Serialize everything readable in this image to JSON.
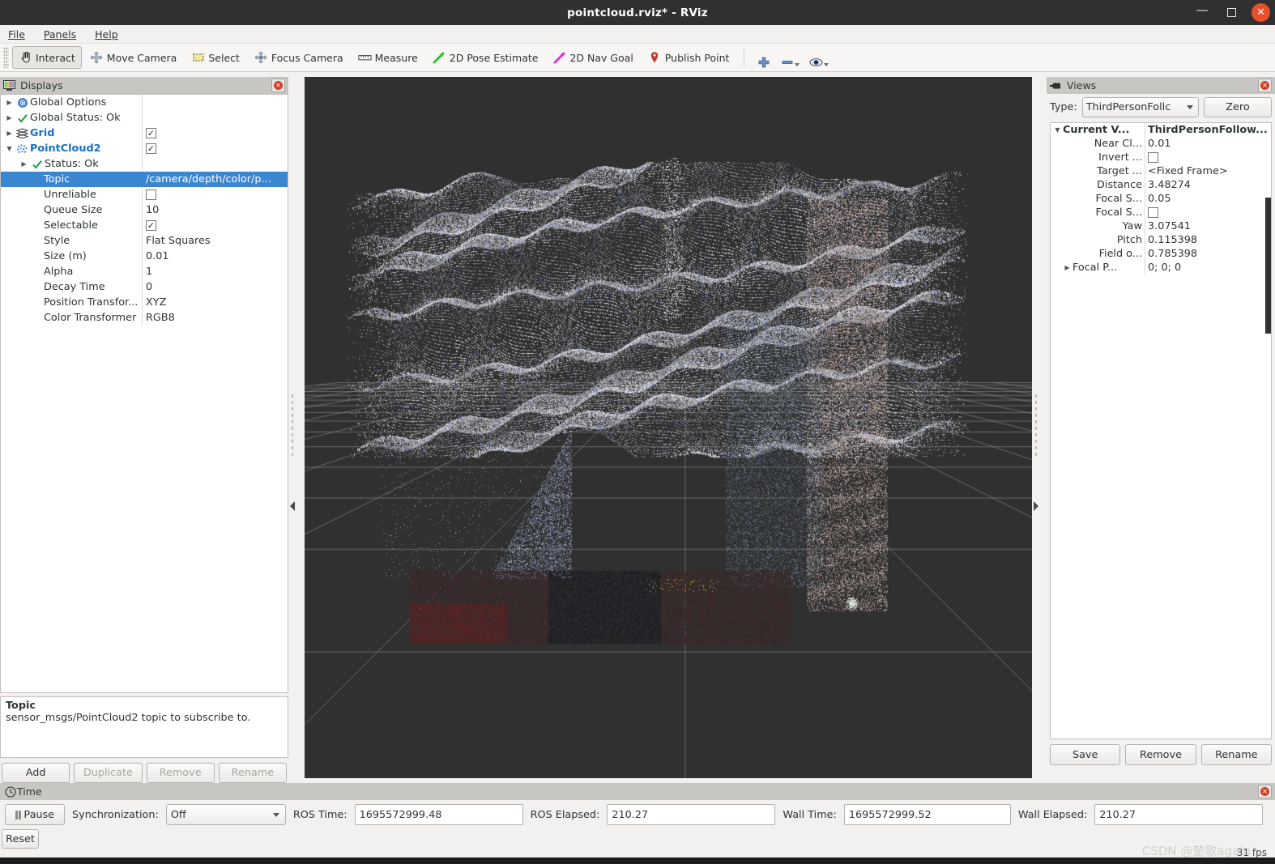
{
  "window": {
    "title": "pointcloud.rviz* - RViz",
    "minimize_label": "—",
    "maximize_label": "",
    "close_label": "✕"
  },
  "menubar": {
    "items": [
      {
        "label": "File"
      },
      {
        "label": "Panels"
      },
      {
        "label": "Help"
      }
    ]
  },
  "toolbar": {
    "buttons": [
      {
        "label": "Interact",
        "icon": "hand-cursor-icon",
        "active": true
      },
      {
        "label": "Move Camera",
        "icon": "move-camera-icon",
        "active": false
      },
      {
        "label": "Select",
        "icon": "select-rect-icon",
        "active": false
      },
      {
        "label": "Focus Camera",
        "icon": "focus-camera-icon",
        "active": false
      },
      {
        "label": "Measure",
        "icon": "ruler-icon",
        "active": false
      },
      {
        "label": "2D Pose Estimate",
        "icon": "green-arrow-icon",
        "active": false
      },
      {
        "label": "2D Nav Goal",
        "icon": "magenta-arrow-icon",
        "active": false
      },
      {
        "label": "Publish Point",
        "icon": "map-pin-icon",
        "active": false
      }
    ],
    "extra_icons": [
      {
        "name": "add-tool-icon",
        "glyph": "plus"
      },
      {
        "name": "remove-tool-icon",
        "glyph": "minus"
      },
      {
        "name": "visibility-eye-icon",
        "glyph": "eye"
      }
    ]
  },
  "displays": {
    "header": "Displays",
    "rows": [
      {
        "arrow": "right",
        "icon": "gear-icon",
        "name": "Global Options",
        "value": "",
        "value_type": "none",
        "indent": 0,
        "bold": false,
        "selected": false
      },
      {
        "arrow": "right",
        "icon": "check-icon",
        "name": "Global Status: Ok",
        "value": "",
        "value_type": "none",
        "indent": 0,
        "bold": false,
        "selected": false
      },
      {
        "arrow": "right",
        "icon": "grid-icon",
        "name": "Grid",
        "value": "",
        "value_type": "checked",
        "indent": 0,
        "bold": true,
        "selected": false
      },
      {
        "arrow": "down",
        "icon": "pointcloud-icon",
        "name": "PointCloud2",
        "value": "",
        "value_type": "checked",
        "indent": 0,
        "bold": true,
        "selected": false
      },
      {
        "arrow": "right",
        "icon": "check-icon",
        "name": "Status: Ok",
        "value": "",
        "value_type": "none",
        "indent": 1,
        "bold": false,
        "selected": false
      },
      {
        "arrow": "",
        "icon": "",
        "name": "Topic",
        "value": "/camera/depth/color/p...",
        "value_type": "text",
        "indent": 2,
        "bold": false,
        "selected": true
      },
      {
        "arrow": "",
        "icon": "",
        "name": "Unreliable",
        "value": "",
        "value_type": "unchecked",
        "indent": 2,
        "bold": false,
        "selected": false
      },
      {
        "arrow": "",
        "icon": "",
        "name": "Queue Size",
        "value": "10",
        "value_type": "text",
        "indent": 2,
        "bold": false,
        "selected": false
      },
      {
        "arrow": "",
        "icon": "",
        "name": "Selectable",
        "value": "",
        "value_type": "checked",
        "indent": 2,
        "bold": false,
        "selected": false
      },
      {
        "arrow": "",
        "icon": "",
        "name": "Style",
        "value": "Flat Squares",
        "value_type": "text",
        "indent": 2,
        "bold": false,
        "selected": false
      },
      {
        "arrow": "",
        "icon": "",
        "name": "Size (m)",
        "value": "0.01",
        "value_type": "text",
        "indent": 2,
        "bold": false,
        "selected": false
      },
      {
        "arrow": "",
        "icon": "",
        "name": "Alpha",
        "value": "1",
        "value_type": "text",
        "indent": 2,
        "bold": false,
        "selected": false
      },
      {
        "arrow": "",
        "icon": "",
        "name": "Decay Time",
        "value": "0",
        "value_type": "text",
        "indent": 2,
        "bold": false,
        "selected": false
      },
      {
        "arrow": "",
        "icon": "",
        "name": "Position Transfor...",
        "value": "XYZ",
        "value_type": "text",
        "indent": 2,
        "bold": false,
        "selected": false
      },
      {
        "arrow": "",
        "icon": "",
        "name": "Color Transformer",
        "value": "RGB8",
        "value_type": "text",
        "indent": 2,
        "bold": false,
        "selected": false
      }
    ],
    "help": {
      "title": "Topic",
      "text": "sensor_msgs/PointCloud2 topic to subscribe to."
    },
    "buttons": [
      {
        "label": "Add",
        "disabled": false
      },
      {
        "label": "Duplicate",
        "disabled": true
      },
      {
        "label": "Remove",
        "disabled": true
      },
      {
        "label": "Rename",
        "disabled": true
      }
    ]
  },
  "views": {
    "header": "Views",
    "type_label": "Type:",
    "type_value": "ThirdPersonFollc",
    "zero_label": "Zero",
    "rows": [
      {
        "arrow": "down",
        "name": "Current V...",
        "value": "ThirdPersonFollow...",
        "value_type": "text",
        "bold": true,
        "indent": 0
      },
      {
        "arrow": "",
        "name": "Near Cl...",
        "value": "0.01",
        "value_type": "text",
        "bold": false,
        "indent": 1
      },
      {
        "arrow": "",
        "name": "Invert ...",
        "value": "",
        "value_type": "unchecked",
        "bold": false,
        "indent": 1
      },
      {
        "arrow": "",
        "name": "Target ...",
        "value": "<Fixed Frame>",
        "value_type": "text",
        "bold": false,
        "indent": 1
      },
      {
        "arrow": "",
        "name": "Distance",
        "value": "3.48274",
        "value_type": "text",
        "bold": false,
        "indent": 1
      },
      {
        "arrow": "",
        "name": "Focal S...",
        "value": "0.05",
        "value_type": "text",
        "bold": false,
        "indent": 1
      },
      {
        "arrow": "",
        "name": "Focal S...",
        "value": "",
        "value_type": "unchecked",
        "bold": false,
        "indent": 1
      },
      {
        "arrow": "",
        "name": "Yaw",
        "value": "3.07541",
        "value_type": "text",
        "bold": false,
        "indent": 1
      },
      {
        "arrow": "",
        "name": "Pitch",
        "value": "0.115398",
        "value_type": "text",
        "bold": false,
        "indent": 1
      },
      {
        "arrow": "",
        "name": "Field o...",
        "value": "0.785398",
        "value_type": "text",
        "bold": false,
        "indent": 1
      },
      {
        "arrow": "right",
        "name": "Focal P...",
        "value": "0; 0; 0",
        "value_type": "text",
        "bold": false,
        "indent": 1
      }
    ],
    "buttons": [
      {
        "label": "Save"
      },
      {
        "label": "Remove"
      },
      {
        "label": "Rename"
      }
    ]
  },
  "time": {
    "header": "Time",
    "pause_label": "Pause",
    "sync_label": "Synchronization:",
    "sync_value": "Off",
    "ros_time_label": "ROS Time:",
    "ros_time_value": "1695572999.48",
    "ros_elapsed_label": "ROS Elapsed:",
    "ros_elapsed_value": "210.27",
    "wall_time_label": "Wall Time:",
    "wall_time_value": "1695572999.52",
    "wall_elapsed_label": "Wall Elapsed:",
    "wall_elapsed_value": "210.27",
    "reset_label": "Reset",
    "fps": "31 fps",
    "watermark": "CSDN @楚歌again"
  },
  "viewport": {
    "background_color": "#303030",
    "grid_color": "#9a9a9a"
  }
}
